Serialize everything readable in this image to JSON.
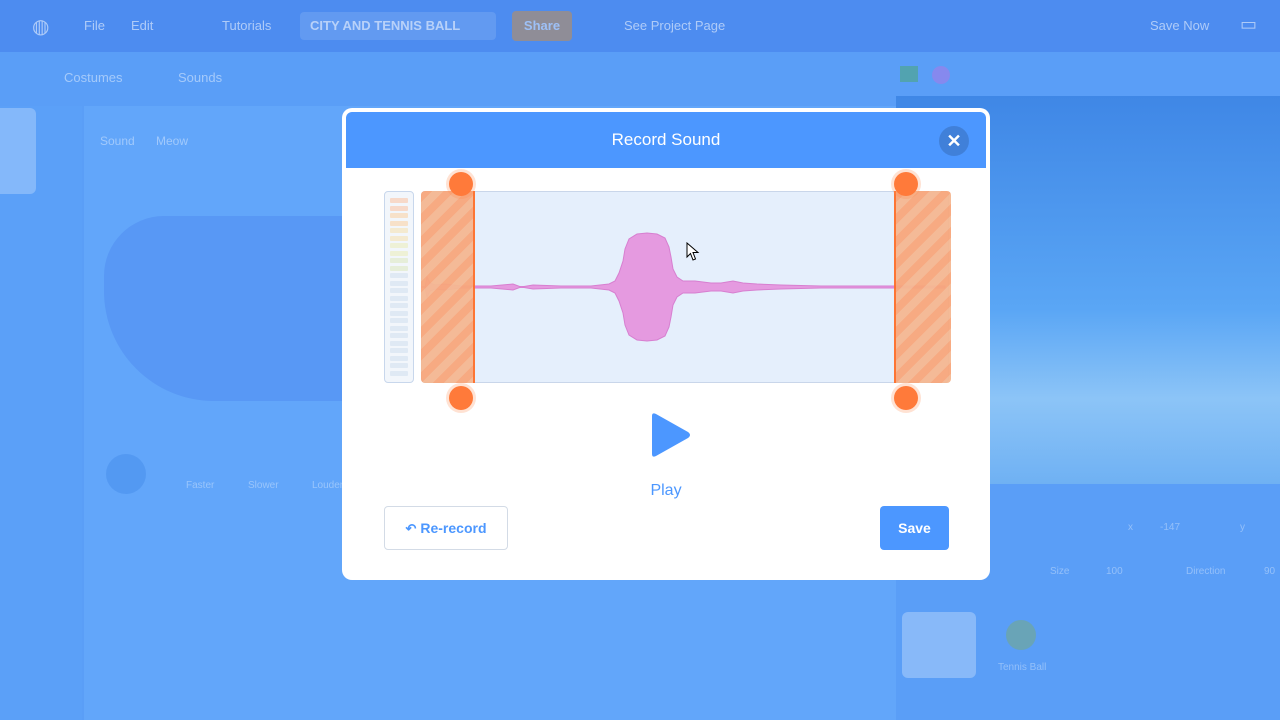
{
  "menubar": {
    "file_label": "File",
    "edit_label": "Edit",
    "tutorials_label": "Tutorials",
    "project_title": "CITY AND TENNIS BALL",
    "share_label": "Share",
    "see_project_page_label": "See Project Page",
    "save_now_label": "Save Now"
  },
  "tabs": {
    "costumes_label": "Costumes",
    "sounds_label": "Sounds"
  },
  "editor": {
    "sound_label": "Sound",
    "sound_name": "Meow",
    "faster_label": "Faster",
    "slower_label": "Slower",
    "louder_label": "Louder"
  },
  "sprite_info": {
    "x_label": "x",
    "x_value": "-147",
    "y_label": "y",
    "size_label": "Size",
    "size_value": "100",
    "direction_label": "Direction",
    "direction_value": "90",
    "sprite2_name": "Tennis Ball"
  },
  "modal": {
    "title": "Record Sound",
    "close_icon": "close-icon",
    "play_label": "Play",
    "rerecord_label": "Re-record",
    "save_label": "Save",
    "trim_start": 0.09,
    "trim_end": 0.9
  },
  "colors": {
    "accent": "#4c97ff",
    "trim": "#ff7a3a",
    "waveform": "#e59ae0"
  }
}
